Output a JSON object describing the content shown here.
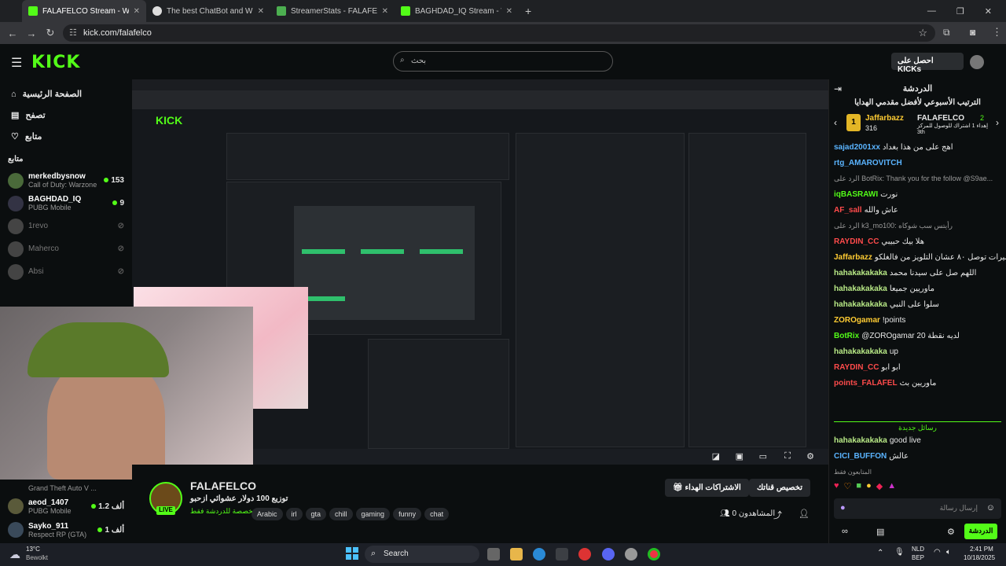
{
  "browser": {
    "tabs": [
      {
        "title": "FALAFELCO Stream - Watch Live"
      },
      {
        "title": "The best ChatBot and Widgets"
      },
      {
        "title": "StreamerStats - FALAFELCO Pr..."
      },
      {
        "title": "BAGHDAD_IQ Stream - Watch L..."
      }
    ],
    "url": "kick.com/falafelco"
  },
  "header": {
    "logo": "KICK",
    "search_placeholder": "بحث",
    "get_kicks": "احصل على KICKs"
  },
  "nav": [
    {
      "label": "الصفحة الرئيسية"
    },
    {
      "label": "تصفح"
    },
    {
      "label": "متابع"
    }
  ],
  "following_label": "متابع",
  "channels": [
    {
      "name": "merkedbysnow",
      "game": "Call of Duty: Warzone",
      "viewers": "153"
    },
    {
      "name": "BAGHDAD_IQ",
      "game": "PUBG Mobile",
      "viewers": "9"
    },
    {
      "name": "1revo"
    },
    {
      "name": "Maherco"
    },
    {
      "name": "Absi"
    }
  ],
  "bottom_channels": [
    {
      "name": "",
      "game": "Grand Theft Auto V ..."
    },
    {
      "name": "aeod_1407",
      "game": "PUBG Mobile",
      "viewers": "1.2 ألف"
    },
    {
      "name": "Sayko_911",
      "game": "Respect RP (GTA)",
      "viewers": "1 ألف"
    }
  ],
  "stream": {
    "channel": "FALAFELCO",
    "title": "توزيع 100 دولار عشوائي ازحبو",
    "category": "مخصصة للدردشة فقط",
    "tags": [
      "Arabic",
      "irl",
      "gta",
      "chill",
      "gaming",
      "funny",
      "chat"
    ],
    "live": "LIVE",
    "viewers_label": "المشاهدون 0",
    "subscribe": "الاشتراكات الهداء",
    "customize": "تخصيص قناتك"
  },
  "chat": {
    "title": "الدردشة",
    "leaderboard_title": "الترتيب الأسبوعي لأفضل مقدمي الهدايا",
    "top1": {
      "name": "Jaffarbazz",
      "count": "316"
    },
    "top2": {
      "name": "FALAFELCO",
      "count": "2"
    },
    "top2_sub": "إهداء 1 اشتراك للوصول للمركز 3th",
    "messages": [
      {
        "user": "sajad2001xx",
        "text": "اهج على من هذا بغداد",
        "color": "#5ab4ff"
      },
      {
        "user": "rtg_AMAROVITCH",
        "text": "",
        "color": "#5ab4ff"
      },
      {
        "user": "",
        "text": "الرد على BotRix: Thank you for the follow @S9ae...",
        "color": "#999999"
      },
      {
        "user": "iqBASRAWI",
        "text": "نورت",
        "color": "#53fc18"
      },
      {
        "user": "AF_sall",
        "text": "عاش والله",
        "color": "#ff4b4b"
      },
      {
        "user": "",
        "text": "الرد على k3_mo100: رأيتس سب شوكاه",
        "color": "#999999"
      },
      {
        "user": "RAYDIN_CC",
        "text": "هلا بيك حبيبي",
        "color": "#ff4b4b"
      },
      {
        "user": "Jaffarbazz",
        "text": "عالسريع شيرات توصل ٨٠ عشان التلويز من فالغلكو",
        "color": "#ffcc33"
      },
      {
        "user": "hahakakakaka",
        "text": "اللهم صل على سيدنا محمد",
        "color": "#b8e986"
      },
      {
        "user": "hahakakakaka",
        "text": "ماوريين جميعا",
        "color": "#b8e986"
      },
      {
        "user": "hahakakakaka",
        "text": "سلوا على النبي",
        "color": "#b8e986"
      },
      {
        "user": "ZOROgamar",
        "text": "!points",
        "color": "#ffcc33"
      },
      {
        "user": "BotRix",
        "text": "@ZOROgamar 20 لديه نقطة",
        "color": "#53fc18"
      },
      {
        "user": "hahakakakaka",
        "text": "up",
        "color": "#b8e986"
      },
      {
        "user": "RAYDIN_CC",
        "text": "ابو ابو",
        "color": "#ff4b4b"
      },
      {
        "user": "points_FALAFEL",
        "text": "ماوريين بث",
        "color": "#ff4b4b"
      }
    ],
    "new_messages": "رسائل جديدة",
    "after": [
      {
        "user": "hahakakakaka",
        "text": "good live",
        "color": "#b8e986"
      },
      {
        "user": "CICI_BUFFON",
        "text": "عالش",
        "color": "#5ab4ff"
      }
    ],
    "followers_only": "المتابعون فقط",
    "input_placeholder": "إرسال رسالة",
    "send": "الدردشة"
  },
  "taskbar": {
    "weather_temp": "13°C",
    "weather_desc": "Bewolkt",
    "search": "Search",
    "lang": "NLD",
    "lang2": "BEP",
    "time": "2:41 PM",
    "date": "10/18/2025"
  }
}
